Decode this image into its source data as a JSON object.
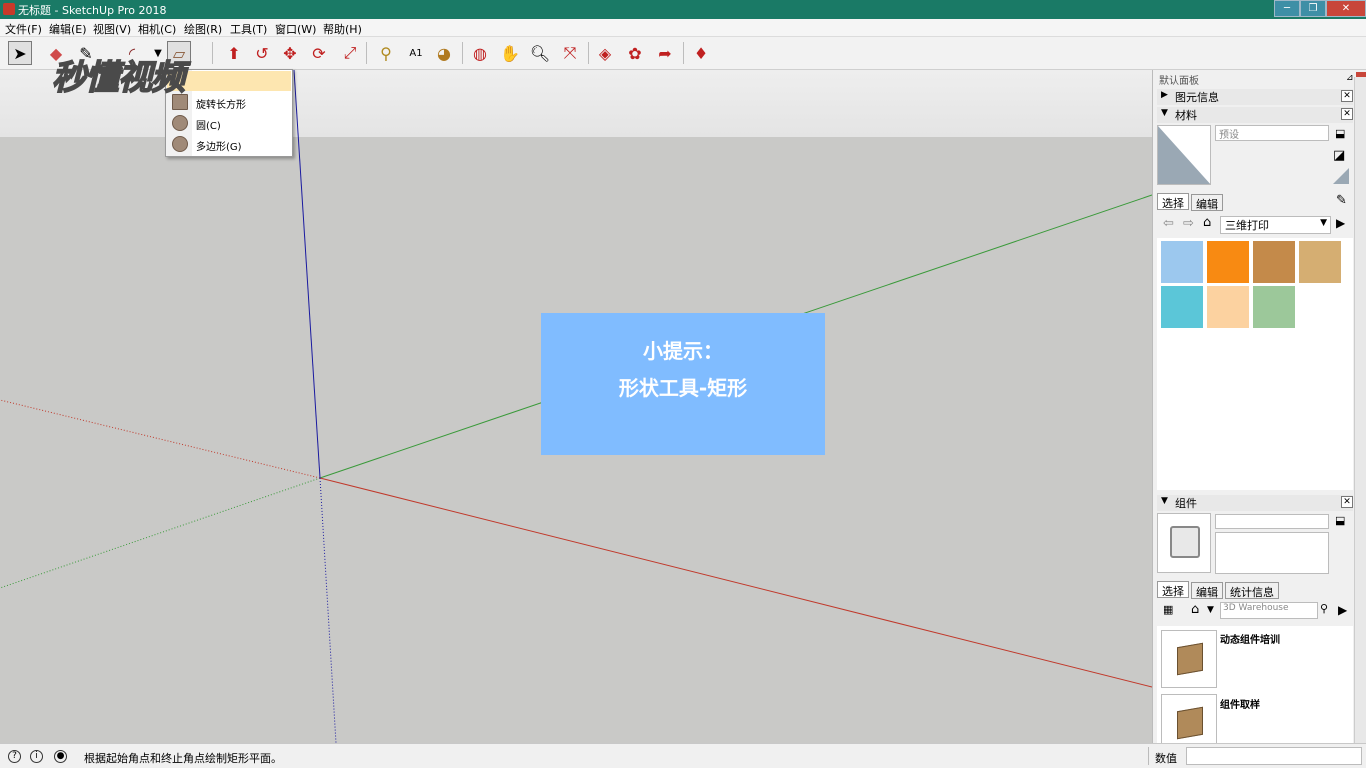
{
  "window": {
    "title": "无标题 - SketchUp Pro 2018",
    "min": "─",
    "max": "❐",
    "close": "✕"
  },
  "menu": [
    "文件(F)",
    "编辑(E)",
    "视图(V)",
    "相机(C)",
    "绘图(R)",
    "工具(T)",
    "窗口(W)",
    "帮助(H)"
  ],
  "watermark": "秒懂视频",
  "dropdown": {
    "items": [
      "旋转长方形",
      "圆(C)",
      "多边形(G)"
    ]
  },
  "hint": {
    "line1": "小提示：",
    "line2": "形状工具-矩形"
  },
  "panel": {
    "title": "默认面板",
    "entity_info": "图元信息",
    "materials": "材料",
    "material_name_placeholder": "预设",
    "tab_select": "选择",
    "tab_edit": "编辑",
    "library": "三维打印",
    "swatch_colors": [
      "#9cc8ee",
      "#f88a12",
      "#c48a4a",
      "#d5ae72",
      "#5bc6d8",
      "#fcd2a0",
      "#9cc89a"
    ],
    "components": "组件",
    "comp_tab_select": "选择",
    "comp_tab_edit": "编辑",
    "comp_tab_stats": "统计信息",
    "search_placeholder": "3D Warehouse",
    "component_items": [
      "动态组件培训",
      "组件取样"
    ]
  },
  "status": {
    "message": "根据起始角点和终止角点绘制矩形平面。",
    "measure_label": "数值"
  },
  "colors": {
    "titlebar": "#1a7a66",
    "hint_bg": "#80bcff",
    "axis_red": "#c0392b",
    "axis_green": "#3a9a3a",
    "axis_blue": "#1a1aa0"
  }
}
